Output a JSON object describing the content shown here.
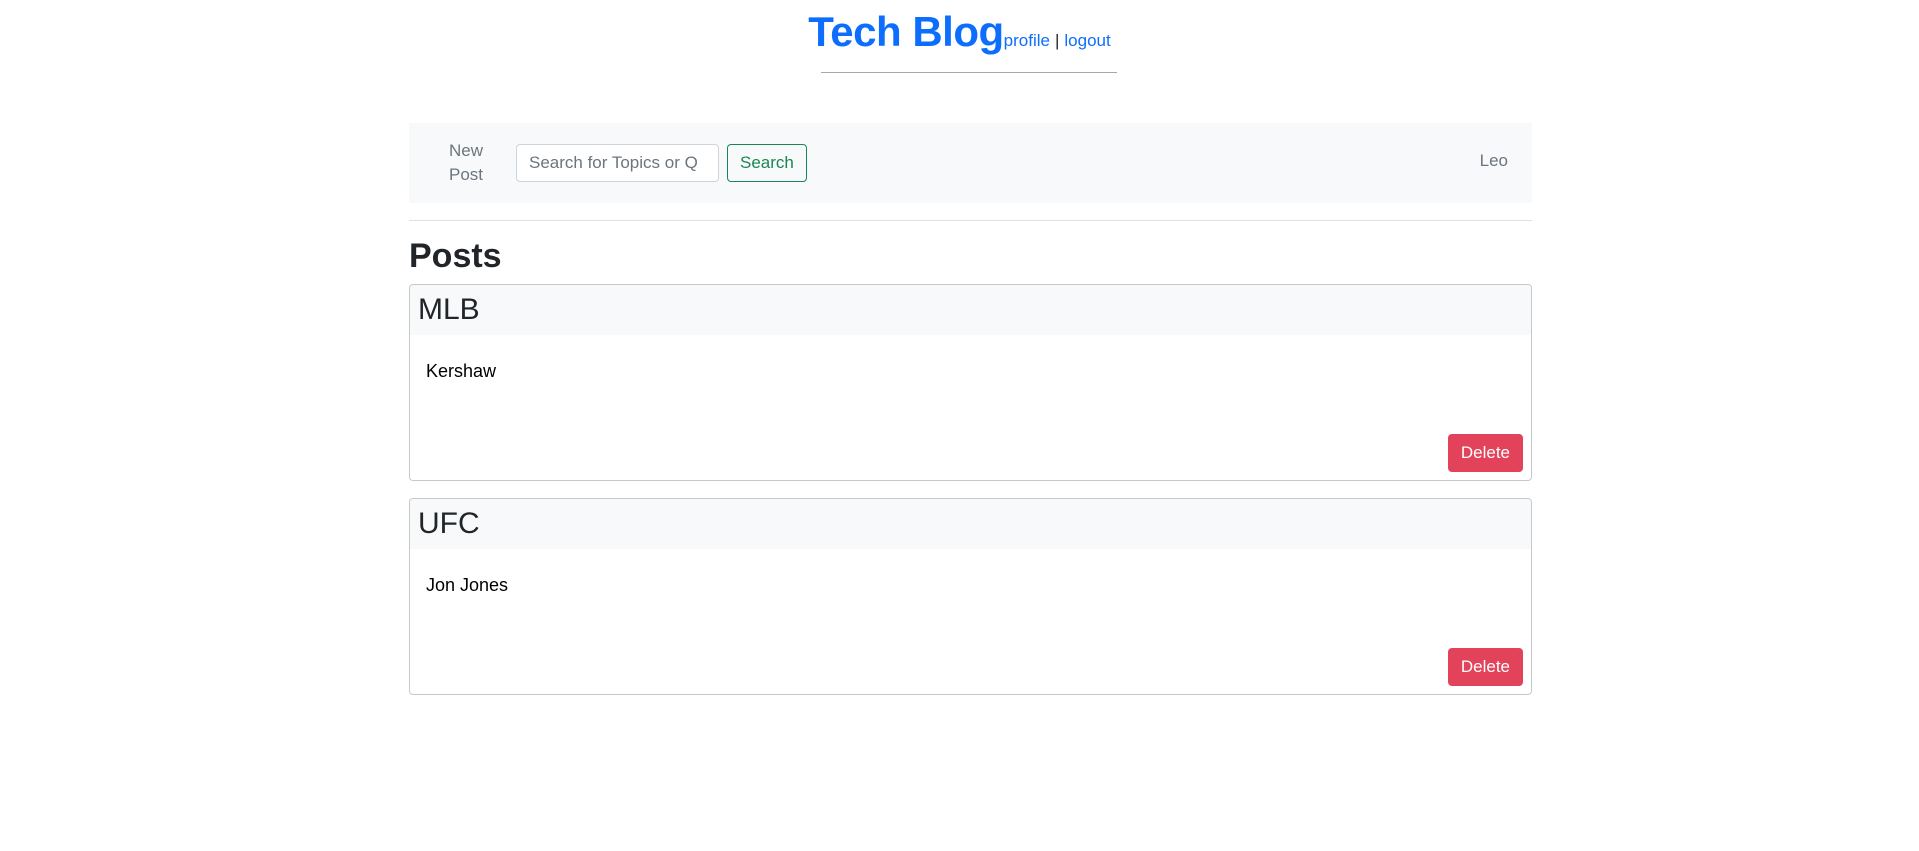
{
  "header": {
    "brand": "Tech Blog",
    "links": [
      {
        "label": "profile"
      },
      {
        "label": "logout"
      }
    ],
    "separator": "|"
  },
  "navbar": {
    "new_post_line1": "New",
    "new_post_line2": "Post",
    "search_placeholder": "Search for Topics or Q",
    "search_value": "",
    "search_button": "Search",
    "user": "Leo"
  },
  "posts_heading": "Posts",
  "posts": [
    {
      "title": "MLB",
      "body": "Kershaw",
      "delete_label": "Delete"
    },
    {
      "title": "UFC",
      "body": "Jon Jones",
      "delete_label": "Delete"
    }
  ],
  "colors": {
    "brand": "#0d6efd",
    "success": "#198754",
    "danger": "#e3435a",
    "muted": "#6c757d",
    "light_bg": "#f8f9fa"
  }
}
